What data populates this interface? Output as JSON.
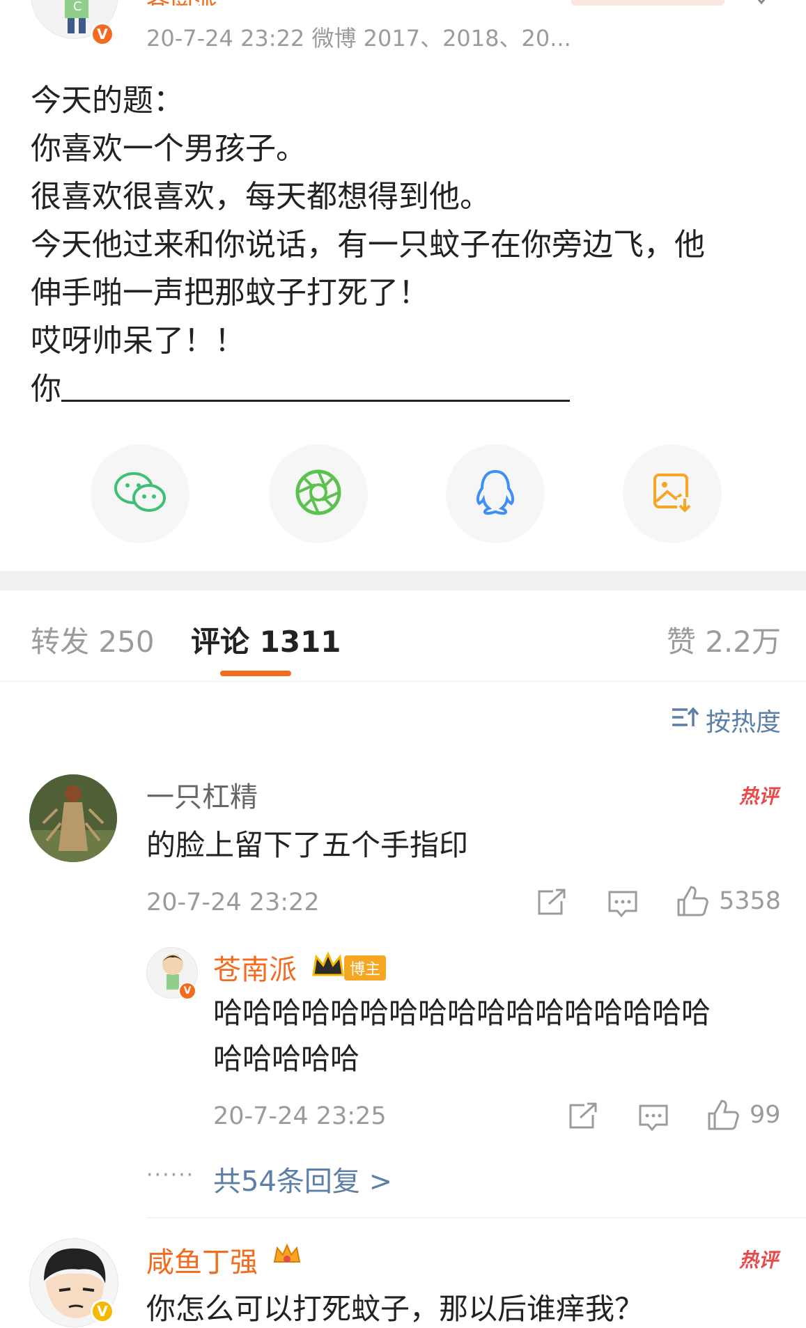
{
  "header": {
    "author_partial": "苍南派",
    "meta": "20-7-24 23:22  微博 2017、2018、20..."
  },
  "post": {
    "lines": [
      "今天的题：",
      "你喜欢一个男孩子。",
      "很喜欢很喜欢，每天都想得到他。",
      "今天他过来和你说话，有一只蚊子在你旁边飞，他",
      "伸手啪一声把那蚊子打死了！",
      "哎呀帅呆了！！",
      "你"
    ]
  },
  "share": {
    "icons": [
      "wechat-icon",
      "moments-icon",
      "qq-icon",
      "save-image-icon"
    ]
  },
  "tabs": {
    "repost_label": "转发",
    "repost_count": "250",
    "comment_label": "评论",
    "comment_count": "1311",
    "like_label": "赞",
    "like_count": "2.2万"
  },
  "sort": {
    "label": "按热度"
  },
  "comments": [
    {
      "username": "一只杠精",
      "hot_tag": "热评",
      "text": "的脸上留下了五个手指印",
      "time": "20-7-24 23:22",
      "likes": "5358",
      "reply": {
        "username": "苍南派",
        "badge": "博主",
        "text_line1": "哈哈哈哈哈哈哈哈哈哈哈哈哈哈哈哈哈",
        "text_line2": "哈哈哈哈哈",
        "time": "20-7-24 23:25",
        "likes": "99"
      },
      "more_replies": "共54条回复 >",
      "dots": "······"
    },
    {
      "username": "咸鱼丁强",
      "hot_tag": "热评",
      "text": "你怎么可以打死蚊子，那以后谁痒我？"
    }
  ],
  "colors": {
    "accent": "#f26b1e",
    "link": "#5b7fa6",
    "muted": "#9b9b9b",
    "hot": "#e84a4a"
  }
}
